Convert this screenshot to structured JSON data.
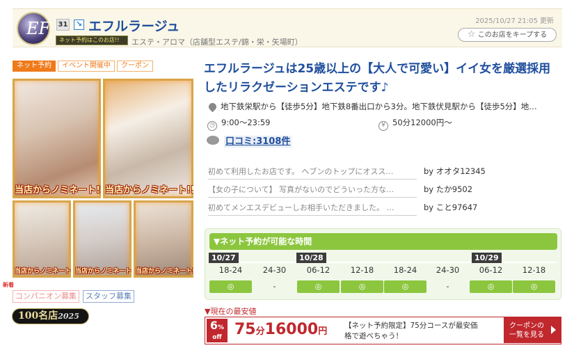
{
  "header": {
    "logo_text": "EF",
    "rank": "31",
    "arrow": "↘",
    "shop_name": "エフルラージュ",
    "badge": "ネット予約はこのお店!!",
    "category": "エステ・アロマ（店舗型エステ/錦・栄・矢場町）",
    "updated": "2025/10/27 21:05 更新",
    "keep_label": "このお店をキープする",
    "keep_icon": "☆"
  },
  "tags": [
    "ネット予約",
    "イベント開催中",
    "クーポン"
  ],
  "photos": {
    "caption_large": "当店からノミネート!!",
    "caption_small": "当店からノミネート!!"
  },
  "recruit": {
    "new_label": "新着",
    "companion": "コンパニオン募集",
    "staff": "スタッフ募集"
  },
  "medal": {
    "text": "100名店",
    "year": "2025"
  },
  "headline": "エフルラージュは25歳以上の【大人で可愛い】イイ女を厳選採用したリラクゼーションエステです♪",
  "access": "地下鉄栄駅から【徒歩5分】地下鉄8番出口から3分。地下鉄伏見駅から【徒歩5分】地…",
  "hours": "9:00〜23:59",
  "price_info": "50分12000円〜",
  "yen_icon": "¥",
  "reviews_label": "口コミ:3108件",
  "reviews": [
    {
      "text": "初めて利用したお店です。 ヘブンのトップにオスス…",
      "by": "by オオタ12345"
    },
    {
      "text": "【女の子について】 写真がないのでどういった方な…",
      "by": "by たか9502"
    },
    {
      "text": "初めてメンエスデビューしお相手いただきました。 …",
      "by": "by こと97647"
    }
  ],
  "reservation": {
    "title": "▼ネット予約が可能な時間",
    "dates": [
      "10/27",
      "10/28",
      "10/29"
    ],
    "slots": [
      "18-24",
      "24-30",
      "06-12",
      "12-18",
      "18-24",
      "24-30",
      "06-12",
      "12-18"
    ],
    "cells": [
      "◎",
      "-",
      "◎",
      "◎",
      "◎",
      "-",
      "◎",
      "◎"
    ]
  },
  "lowest": {
    "label": "▼現在の最安値",
    "pct": "6",
    "pct_unit": "%",
    "off": "off",
    "minutes": "75",
    "minutes_unit": "分",
    "amount": "16000",
    "yen": "円",
    "desc": "【ネット予約限定】75分コースが最安価格で遊べちゃう！",
    "coupon_line1": "クーポンの",
    "coupon_line2": "一覧を見る"
  },
  "colors": {
    "accent": "#1f4e9c",
    "green": "#8cc63f",
    "red": "#c0282d",
    "orange": "#ef7a1a"
  }
}
